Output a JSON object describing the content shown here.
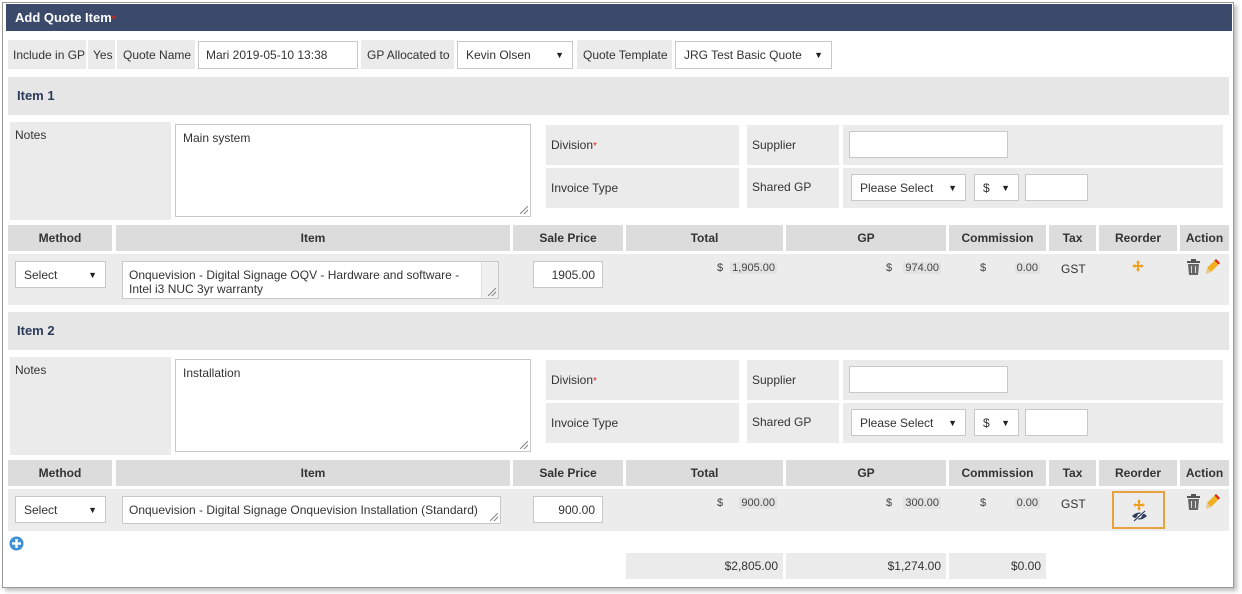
{
  "title": "Add Quote Item",
  "required_marker": "*",
  "header": {
    "include_in_gp_label": "Include in GP",
    "include_in_gp_value": "Yes",
    "quote_name_label": "Quote Name",
    "quote_name_value": "Mari 2019-05-10 13:38",
    "gp_allocated_label": "GP Allocated to",
    "gp_allocated_value": "Kevin Olsen",
    "quote_template_label": "Quote Template",
    "quote_template_value": "JRG Test Basic Quote"
  },
  "labels": {
    "notes": "Notes",
    "division": "Division",
    "supplier": "Supplier",
    "invoice_type": "Invoice Type",
    "shared_gp": "Shared GP",
    "please_select": "Please Select",
    "currency_option": "$"
  },
  "columns": [
    "Method",
    "Item",
    "Sale Price",
    "Total",
    "GP",
    "Commission",
    "Tax",
    "Reorder",
    "Action"
  ],
  "items": [
    {
      "heading": "Item 1",
      "notes": "Main system",
      "method": "Select",
      "item_text": "Onquevision - Digital Signage OQV - Hardware and software - Intel i3 NUC 3yr warranty",
      "sale_price": "1905.00",
      "total": "1,905.00",
      "gp": "974.00",
      "commission": "0.00",
      "tax": "GST"
    },
    {
      "heading": "Item 2",
      "notes": "Installation",
      "method": "Select",
      "item_text": "Onquevision - Digital Signage Onquevision Installation (Standard)",
      "sale_price": "900.00",
      "total": "900.00",
      "gp": "300.00",
      "commission": "0.00",
      "tax": "GST"
    }
  ],
  "currency_symbol": "$",
  "totals": {
    "total": "$2,805.00",
    "gp": "$1,274.00",
    "commission": "$0.00"
  },
  "colors": {
    "title_bar": "#3b4a6b",
    "required": "#d9261c",
    "highlight": "#e6a23c",
    "reorder_icon": "#f0a020"
  },
  "icons": [
    "reorder-move-icon",
    "eye-slash-icon",
    "trash-icon",
    "pencil-icon",
    "add-plus-icon"
  ]
}
